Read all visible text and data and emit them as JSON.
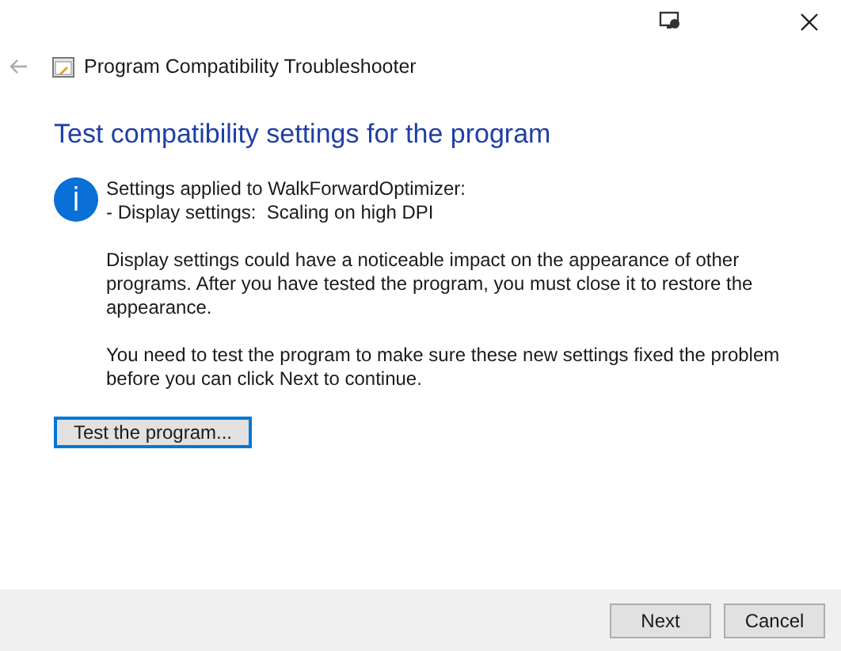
{
  "header": {
    "title": "Program Compatibility Troubleshooter"
  },
  "heading": "Test compatibility settings for the program",
  "info_lines": [
    "Settings applied to WalkForwardOptimizer:",
    "- Display settings:  Scaling on high DPI"
  ],
  "paragraphs": [
    "Display settings could have a noticeable impact on the appearance of other programs. After you have tested the program, you must close it to restore the appearance.",
    "You need to test the program to make sure these new settings fixed the problem before you can click Next to continue."
  ],
  "test_button": "Test the program...",
  "footer_buttons": [
    "Next",
    "Cancel"
  ]
}
